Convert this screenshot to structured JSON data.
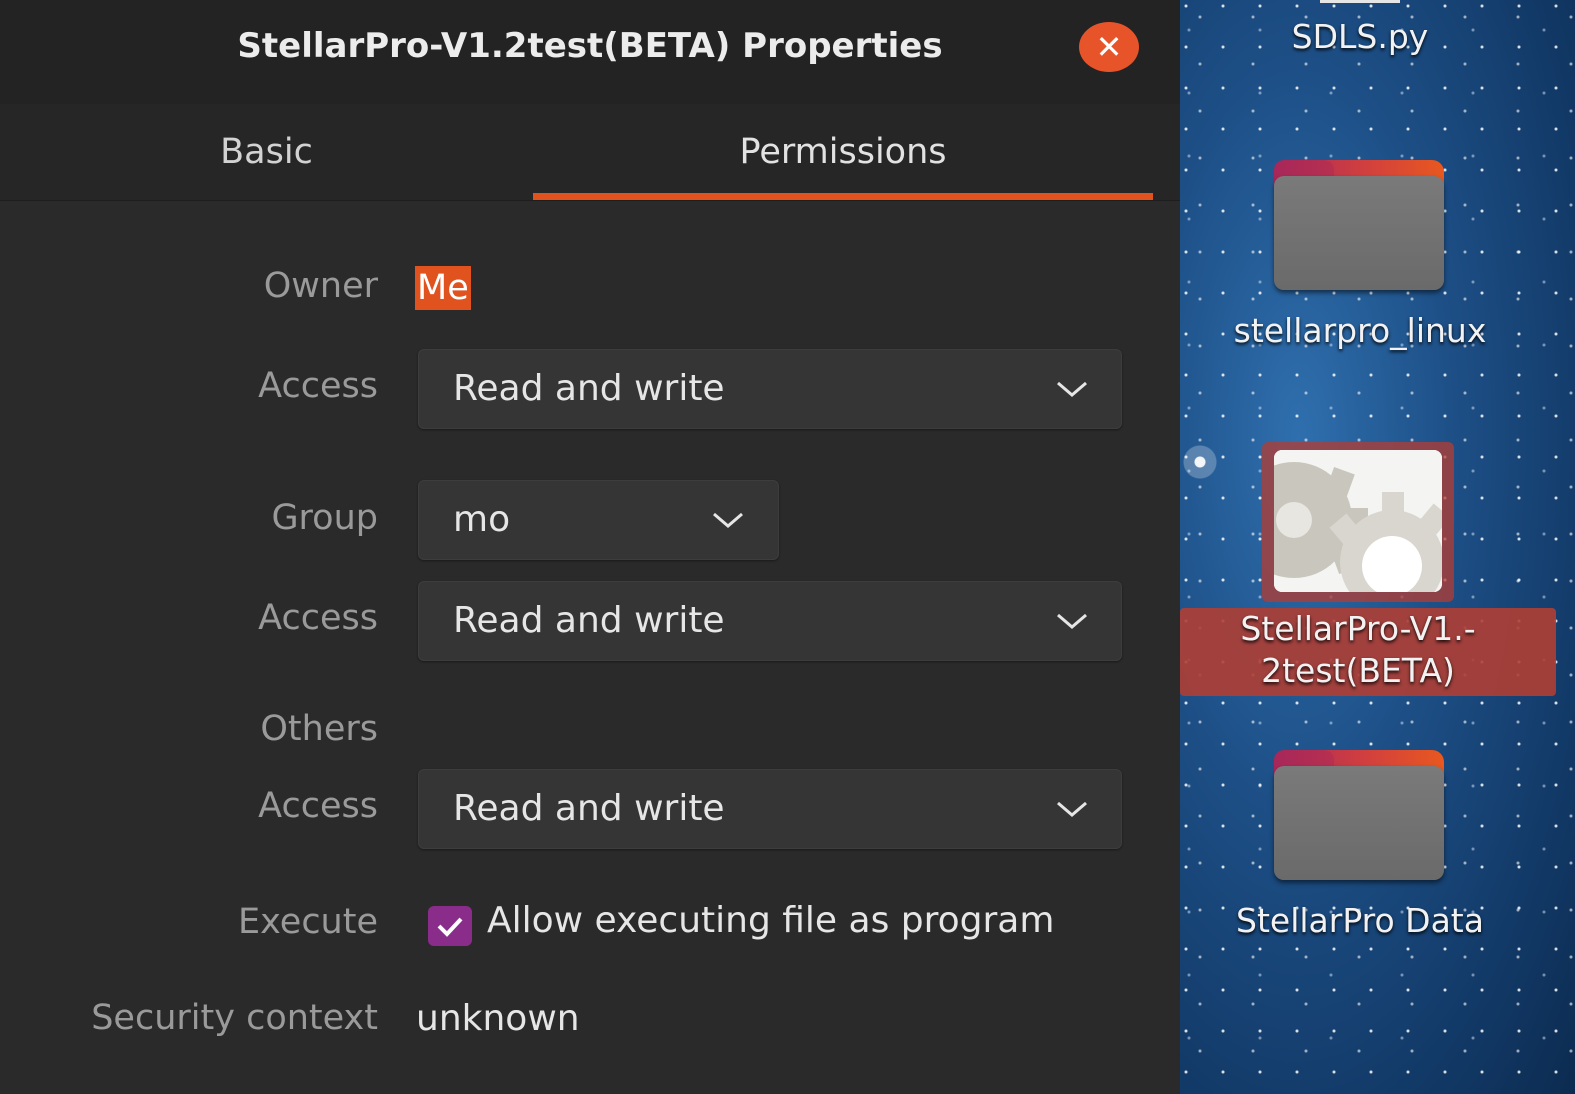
{
  "dialog": {
    "title": "StellarPro-V1.2test(BETA) Properties",
    "close_icon": "close-icon",
    "tabs": [
      {
        "label": "Basic",
        "active": false
      },
      {
        "label": "Permissions",
        "active": true
      }
    ],
    "owner": {
      "label": "Owner",
      "value": "Me"
    },
    "owner_access": {
      "label": "Access",
      "value": "Read and write"
    },
    "group": {
      "label": "Group",
      "value": "mo"
    },
    "group_access": {
      "label": "Access",
      "value": "Read and write"
    },
    "others": {
      "label": "Others"
    },
    "others_access": {
      "label": "Access",
      "value": "Read and write"
    },
    "execute": {
      "label": "Execute",
      "checked": true,
      "checkbox_label": "Allow executing file as program"
    },
    "security_context": {
      "label": "Security context",
      "value": "unknown"
    }
  },
  "desktop": {
    "icons": [
      {
        "label": "SDLS.py",
        "icon": "python-file-icon"
      },
      {
        "label": "stellarpro_linux",
        "icon": "folder-icon"
      },
      {
        "label_line1": "StellarPro-V1.-",
        "label_line2": "2test(BETA)",
        "icon": "executable-gear-icon",
        "selected": true
      },
      {
        "label": "StellarPro Data",
        "icon": "folder-icon"
      }
    ]
  },
  "colors": {
    "accent": "#e0531f",
    "checkbox": "#8a2d8a",
    "dialog_bg": "#2a2a2a",
    "selection": "#b03e34"
  }
}
